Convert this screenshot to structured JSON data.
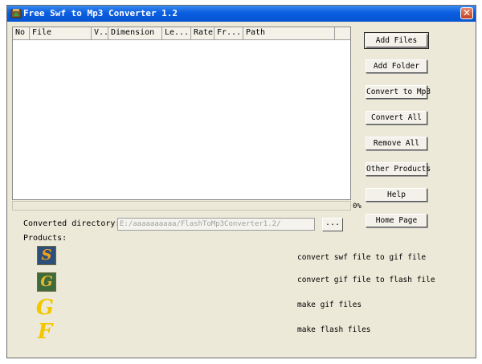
{
  "window": {
    "title": "Free Swf to Mp3 Converter 1.2"
  },
  "list": {
    "columns": [
      "No",
      "File",
      "V..",
      "Dimension",
      "Le...",
      "Rate",
      "Fr...",
      "Path"
    ]
  },
  "progress": {
    "value": 0,
    "label": "0%"
  },
  "buttons": {
    "add_files": "Add Files",
    "add_folder": "Add Folder",
    "convert_to_mp3": "Convert to Mp3",
    "convert_all": "Convert All",
    "remove_all": "Remove All",
    "other_products": "Other Products",
    "help": "Help",
    "home_page": "Home Page",
    "browse": "..."
  },
  "output": {
    "label": "Converted directory:",
    "path": "E:/aaaaaaaaaa/FlashToMp3Converter1.2/"
  },
  "products": {
    "label": "Products:",
    "items": [
      {
        "glyph": "S",
        "icon": "swf-to-gif-icon",
        "description": "convert swf file to gif file"
      },
      {
        "glyph": "G",
        "icon": "gif-to-flash-icon",
        "description": "convert gif file to flash file"
      },
      {
        "glyph": "G",
        "icon": "gif-maker-icon",
        "description": "make gif files"
      },
      {
        "glyph": "F",
        "icon": "flash-maker-icon",
        "description": "make flash files"
      }
    ]
  },
  "colors": {
    "titlebar": "#0a5ee0",
    "window_bg": "#ece9d8",
    "close_button": "#c3401f",
    "gif_icon": "#f2c700"
  }
}
